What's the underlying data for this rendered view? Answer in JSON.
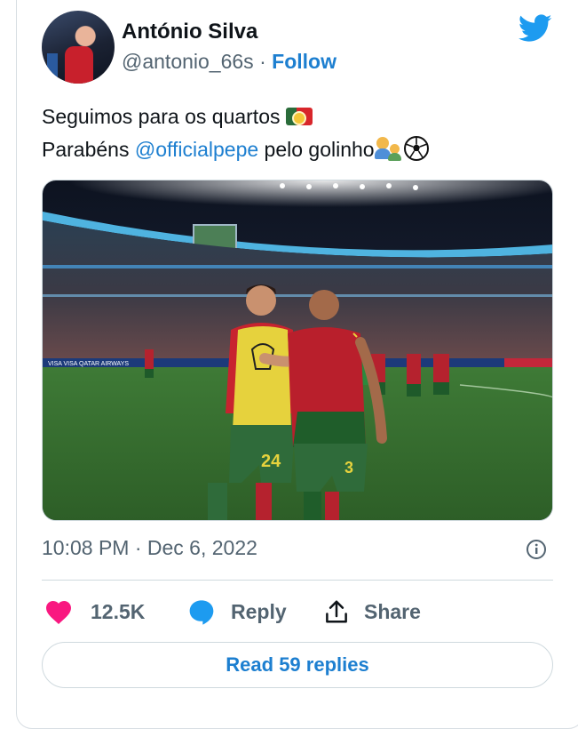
{
  "tweet": {
    "author_name": "António Silva",
    "handle": "@antonio_66s",
    "separator": "·",
    "follow_label": "Follow",
    "text_line1": "Seguimos para os quartos",
    "text_line2_prefix": "Parabéns ",
    "mention": "@officialpepe",
    "text_line2_suffix": " pelo golinho",
    "emojis": [
      "flag-portugal-icon",
      "people-hugging-icon",
      "soccer-ball-icon"
    ],
    "photo": {
      "ad_board_text": "VISA  VISA  QATAR AIRWAYS",
      "jersey_numbers": [
        "24",
        "3"
      ]
    },
    "timestamp": "10:08 PM · Dec 6, 2022",
    "actions": {
      "like_count": "12.5K",
      "reply_label": "Reply",
      "share_label": "Share"
    },
    "read_replies_label": "Read 59 replies"
  },
  "colors": {
    "accent": "#1d7fd0",
    "twitter_blue": "#1d9bf0",
    "like_pink": "#f91880",
    "muted_text": "#536471",
    "border": "#cfd9de"
  }
}
